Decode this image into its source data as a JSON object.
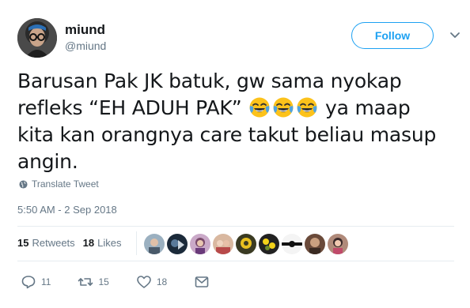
{
  "user": {
    "name": "miund",
    "handle": "@miund"
  },
  "follow_button": {
    "label": "Follow"
  },
  "tweet": {
    "lines": [
      "Barusan Pak JK batuk, gw sama nyokap",
      "refleks “EH ADUH PAK”",
      "ya maap",
      "kita kan orangnya care takut beliau masup",
      "angin."
    ],
    "emoji_icon": "face-with-tears-of-joy-emoji",
    "emoji_count": 3
  },
  "translate": {
    "label": "Translate Tweet",
    "icon": "globe-icon"
  },
  "timestamp": "5:50 AM - 2 Sep 2018",
  "stats": {
    "retweets_count": "15",
    "retweets_label": "Retweets",
    "likes_count": "18",
    "likes_label": "Likes"
  },
  "likers_count": 9,
  "actions": {
    "reply_count": "11",
    "retweet_count": "15",
    "like_count": "18"
  },
  "colors": {
    "accent": "#1da1f2",
    "secondary_text": "#657786",
    "primary_text": "#14171a",
    "divider": "#e6ecf0"
  }
}
